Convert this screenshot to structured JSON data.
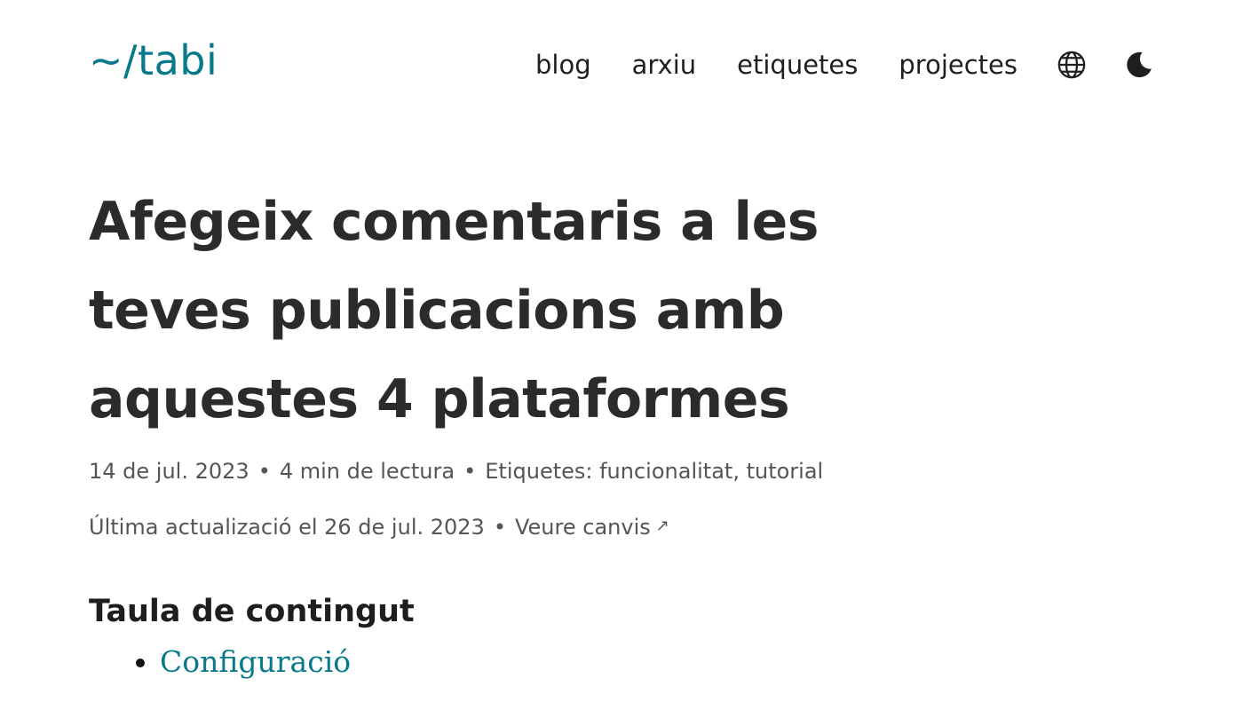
{
  "header": {
    "site_title": "~/tabi",
    "nav": [
      {
        "label": "blog"
      },
      {
        "label": "arxiu"
      },
      {
        "label": "etiquetes"
      },
      {
        "label": "projectes"
      }
    ],
    "icons": {
      "language": "globe-icon",
      "theme": "moon-icon"
    }
  },
  "article": {
    "title": "Afegeix comentaris a les teves publicacions amb aquestes 4 plataformes",
    "date": "14 de jul. 2023",
    "reading_time": "4 min de lectura",
    "tags_label": "Etiquetes:",
    "tags": [
      "funcionalitat",
      "tutorial"
    ],
    "tag_separator": ", ",
    "bullet": "•",
    "updated_text": "Última actualizació el 26 de jul. 2023",
    "changes_link": "Veure canvis",
    "external_arrow": "↗"
  },
  "toc": {
    "title": "Taula de contingut",
    "items": [
      {
        "label": "Configuració"
      }
    ]
  },
  "colors": {
    "accent": "#08798a",
    "text": "#2b2b2b",
    "meta": "#555555"
  }
}
